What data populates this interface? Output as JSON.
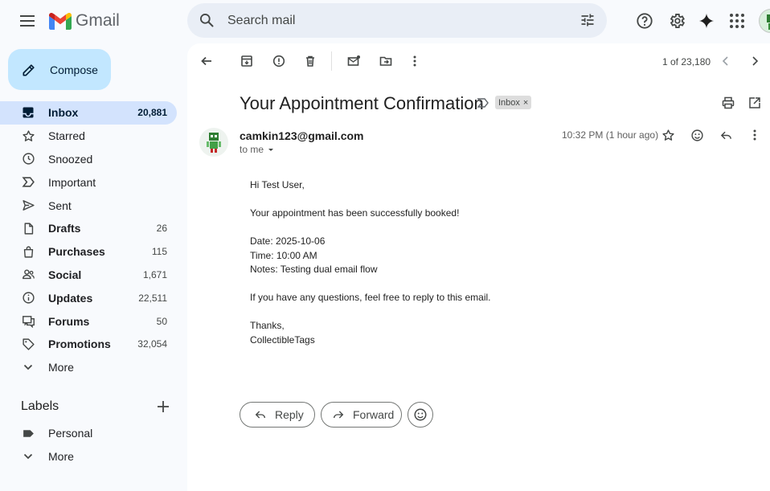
{
  "header": {
    "app_name": "Gmail",
    "search_placeholder": "Search mail"
  },
  "compose_label": "Compose",
  "nav": [
    {
      "label": "Inbox",
      "count": "20,881",
      "icon": "inbox-icon",
      "active": true,
      "bold": true
    },
    {
      "label": "Starred",
      "count": "",
      "icon": "star-icon"
    },
    {
      "label": "Snoozed",
      "count": "",
      "icon": "clock-icon"
    },
    {
      "label": "Important",
      "count": "",
      "icon": "important-icon"
    },
    {
      "label": "Sent",
      "count": "",
      "icon": "send-icon"
    },
    {
      "label": "Drafts",
      "count": "26",
      "icon": "draft-icon",
      "bold": true
    },
    {
      "label": "Purchases",
      "count": "115",
      "icon": "purchases-icon",
      "bold": true
    },
    {
      "label": "Social",
      "count": "1,671",
      "icon": "social-icon",
      "bold": true
    },
    {
      "label": "Updates",
      "count": "22,511",
      "icon": "updates-icon",
      "bold": true
    },
    {
      "label": "Forums",
      "count": "50",
      "icon": "forums-icon",
      "bold": true
    },
    {
      "label": "Promotions",
      "count": "32,054",
      "icon": "tag-icon",
      "bold": true
    },
    {
      "label": "More",
      "count": "",
      "icon": "chevron-down-icon"
    }
  ],
  "labels": {
    "heading": "Labels",
    "items": [
      {
        "label": "Personal",
        "icon": "label-icon"
      },
      {
        "label": "More",
        "icon": "chevron-down-icon"
      }
    ]
  },
  "toolbar": {
    "pager": "1 of 23,180"
  },
  "email": {
    "subject": "Your Appointment Confirmation",
    "badge": "Inbox",
    "sender": "camkin123@gmail.com",
    "to": "to me",
    "time": "10:32 PM (1 hour ago)",
    "body": [
      "Hi Test User,",
      "",
      "Your appointment has been successfully booked!",
      "",
      "Date: 2025-10-06",
      "Time: 10:00 AM",
      "Notes: Testing dual email flow",
      "",
      "If you have any questions, feel free to reply to this email.",
      "",
      "Thanks,",
      "CollectibleTags"
    ]
  },
  "actions": {
    "reply": "Reply",
    "forward": "Forward"
  },
  "colors": {
    "accent": "#c2e7ff",
    "active_nav": "#d3e3fd",
    "background": "#f8fafd"
  }
}
